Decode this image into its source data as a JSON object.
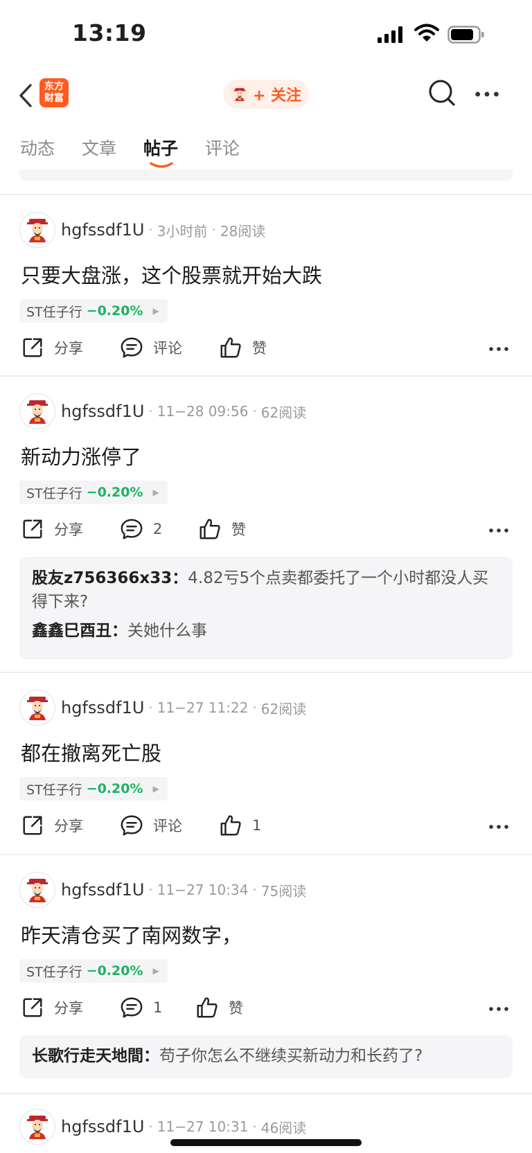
{
  "status_bar": {
    "time": "13:19"
  },
  "nav": {
    "logo_line1": "东方",
    "logo_line2": "财富",
    "follow_label": "+ 关注"
  },
  "tabs": [
    {
      "label": "动态"
    },
    {
      "label": "文章"
    },
    {
      "label": "帖子",
      "active": true
    },
    {
      "label": "评论"
    }
  ],
  "accent_color": "#ff5a1f",
  "stock_change_color": "#1db35f",
  "posts": [
    {
      "author": "hgfssdf1U",
      "time": "3小时前",
      "reads": "28阅读",
      "title": "只要大盘涨，这个股票就开始大跌",
      "stock": {
        "name": "ST任子行",
        "change": "−0.20%"
      },
      "actions": {
        "share": "分享",
        "comment": "评论",
        "like": "赞"
      }
    },
    {
      "author": "hgfssdf1U",
      "time": "11−28 09:56",
      "reads": "62阅读",
      "title": "新动力涨停了",
      "stock": {
        "name": "ST任子行",
        "change": "−0.20%"
      },
      "actions": {
        "share": "分享",
        "comment": "2",
        "like": "赞"
      },
      "comments": [
        {
          "user": "股友z756366x33：",
          "text": "4.82亏5个点卖都委托了一个小时都没人买得下来?"
        },
        {
          "user": "鑫鑫巳酉丑：",
          "text": "关她什么事"
        }
      ]
    },
    {
      "author": "hgfssdf1U",
      "time": "11−27 11:22",
      "reads": "62阅读",
      "title": "都在撤离死亡股",
      "stock": {
        "name": "ST任子行",
        "change": "−0.20%"
      },
      "actions": {
        "share": "分享",
        "comment": "评论",
        "like": "1"
      }
    },
    {
      "author": "hgfssdf1U",
      "time": "11−27 10:34",
      "reads": "75阅读",
      "title": "昨天清仓买了南网数字，",
      "stock": {
        "name": "ST任子行",
        "change": "−0.20%"
      },
      "actions": {
        "share": "分享",
        "comment": "1",
        "like": "赞"
      },
      "comments": [
        {
          "user": "长歌行走天地間：",
          "text": "苟子你怎么不继续买新动力和长药了?"
        }
      ]
    },
    {
      "author": "hgfssdf1U",
      "time": "11−27 10:31",
      "reads": "46阅读"
    }
  ]
}
